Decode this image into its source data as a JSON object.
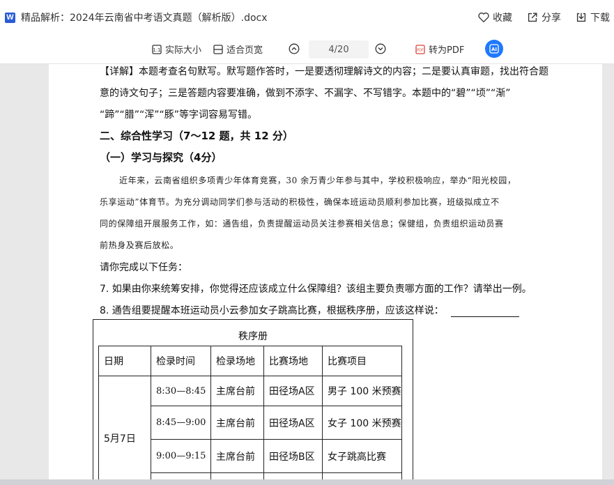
{
  "titlebar": {
    "app_logo": "W",
    "doc_title": "精品解析：2024年云南省中考语文真题（解析版）.docx",
    "favorite_label": "收藏",
    "share_label": "分享",
    "download_label": "下载",
    "icons": [
      "heart-icon",
      "share-icon",
      "download-icon"
    ]
  },
  "toolbar": {
    "actual_size_label": "实际大小",
    "fit_page_label": "适合页宽",
    "page_indicator": "4/20",
    "to_pdf_label": "转为PDF",
    "icons": [
      "actual-size-icon",
      "fit-page-icon",
      "prev-page-icon",
      "next-page-icon",
      "pdf-icon",
      "ai-assistant-icon"
    ]
  },
  "doc": {
    "analysis_line1": "【详解】本题考查名句默写。默写题作答时，一是要透彻理解诗文的内容；二是要认真审题，找出符合题",
    "analysis_line2": "意的诗文句子；三是答题内容要准确，做到不添字、不漏字、不写错字。本题中的“碧”“顷”“渐”",
    "analysis_line3": "“蹄”“腊”“浑”“豚”等字词容易写错。",
    "section_heading": "二、综合性学习（7～12 题，共 12 分）",
    "sub_heading": "（一）学习与探究（4分）",
    "passage_line1": "近年来，云南省组织多项青少年体育竞赛，30 余万青少年参与其中，学校积极响应，举办“阳光校园，",
    "passage_line2": "乐享运动”体育节。为充分调动同学们参与活动的积极性，确保本班运动员顺利参加比赛，班级拟成立不",
    "passage_line3": "同的保障组开展服务工作，如：通告组，负责提醒运动员关注参赛相关信息；保健组，负责组织运动员赛",
    "passage_line4": "前热身及赛后放松。",
    "task_intro": "请你完成以下任务：",
    "q7": "7. 如果由你来统筹安排，你觉得还应该成立什么保障组？该组主要负责哪方面的工作？请举出一例。",
    "q8": "8. 通告组要提醒本班运动员小云参加女子跳高比赛，根据秩序册，应该这样说："
  },
  "table": {
    "caption": "秩序册",
    "headers": [
      "日期",
      "检录时间",
      "检录场地",
      "比赛场地",
      "比赛项目"
    ],
    "date_cell": "5月7日",
    "rows": [
      [
        "8:30—8:45",
        "主席台前",
        "田径场A区",
        "男子 100 米预赛"
      ],
      [
        "8:45—9:00",
        "主席台前",
        "田径场A区",
        "女子 100 米预赛"
      ],
      [
        "9:00—9:15",
        "主席台前",
        "田径场B区",
        "女子跳高比赛"
      ]
    ]
  }
}
